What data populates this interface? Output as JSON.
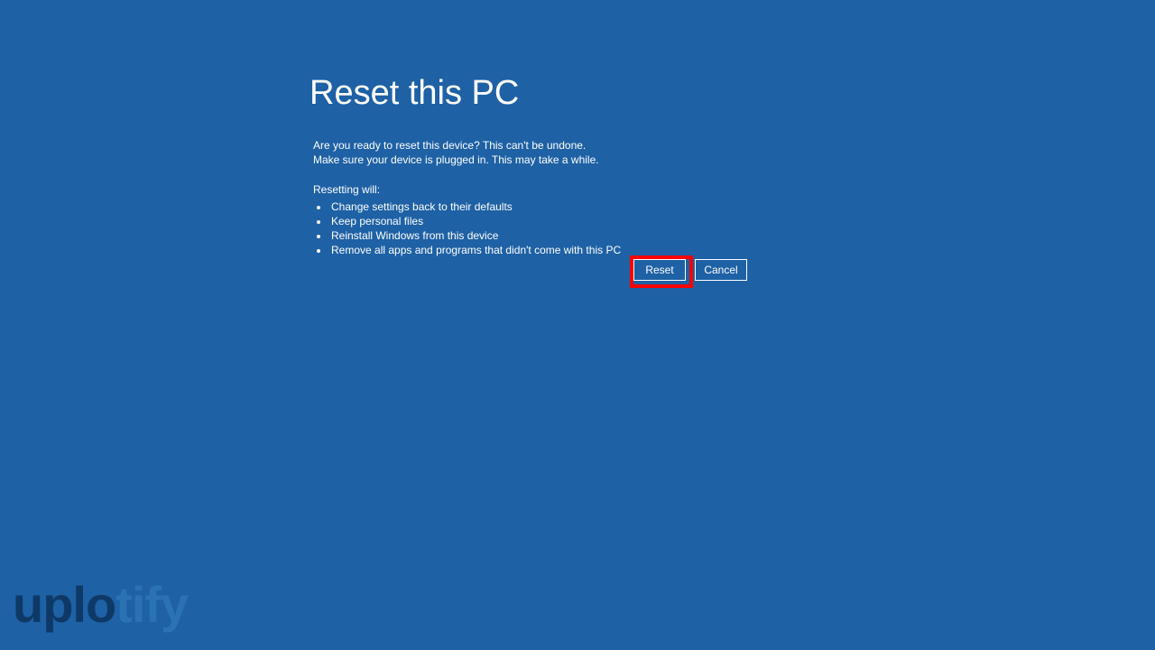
{
  "header": {
    "title": "Reset this PC"
  },
  "description": {
    "line1": "Are you ready to reset this device? This can't be undone.",
    "line2": "Make sure your device is plugged in. This may take a while."
  },
  "resetting": {
    "label": "Resetting will:",
    "items": [
      "Change settings back to their defaults",
      "Keep personal files",
      "Reinstall Windows from this device",
      "Remove all apps and programs that didn't come with this PC"
    ]
  },
  "buttons": {
    "reset": "Reset",
    "cancel": "Cancel"
  },
  "watermark": {
    "part1": "uplo",
    "part2": "tify"
  }
}
